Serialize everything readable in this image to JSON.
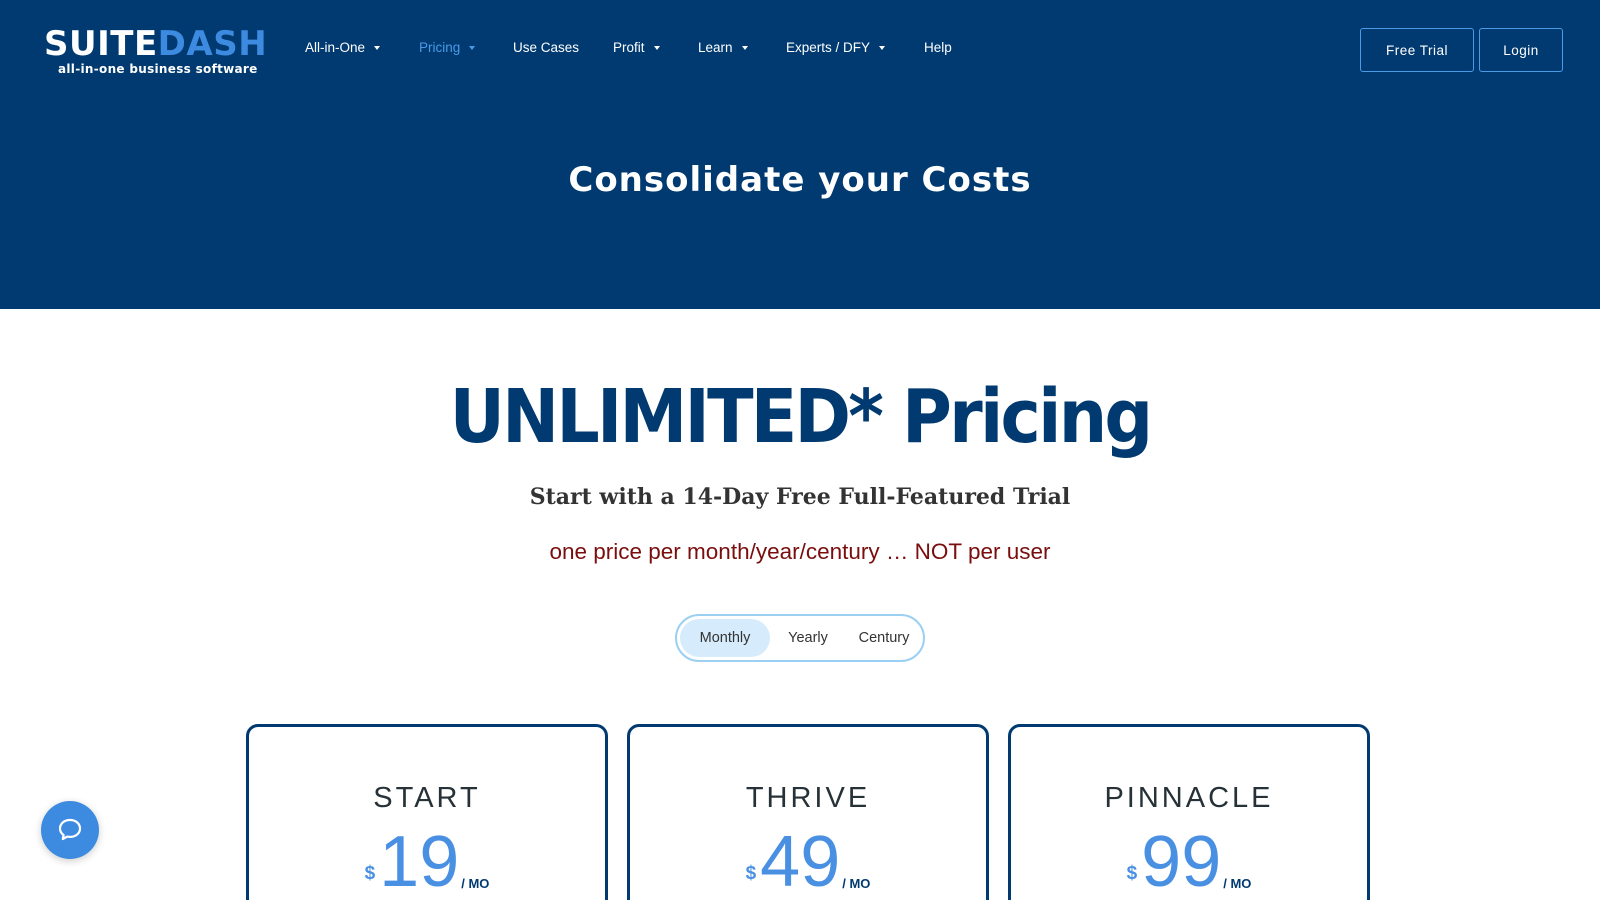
{
  "brand": {
    "name_part1": "SUITE",
    "name_part2": "DASH",
    "tagline": "all-in-one business software"
  },
  "nav": {
    "items": [
      {
        "label": "All-in-One",
        "has_dropdown": true,
        "active": false
      },
      {
        "label": "Pricing",
        "has_dropdown": true,
        "active": true
      },
      {
        "label": "Use Cases",
        "has_dropdown": false,
        "active": false
      },
      {
        "label": "Profit",
        "has_dropdown": true,
        "active": false
      },
      {
        "label": "Learn",
        "has_dropdown": true,
        "active": false
      },
      {
        "label": "Experts / DFY",
        "has_dropdown": true,
        "active": false
      },
      {
        "label": "Help",
        "has_dropdown": false,
        "active": false
      }
    ],
    "free_trial_label": "Free Trial",
    "login_label": "Login"
  },
  "hero": {
    "title": "Consolidate your Costs"
  },
  "pricing": {
    "title": "UNLIMITED* Pricing",
    "subtitle": "Start with a 14-Day Free Full-Featured Trial",
    "tagline": "one price per month/year/century … NOT per user",
    "billing_options": [
      "Monthly",
      "Yearly",
      "Century"
    ],
    "selected_billing": "Monthly",
    "plans": [
      {
        "name": "START",
        "currency": "$",
        "price": "19",
        "period": "/ MO"
      },
      {
        "name": "THRIVE",
        "currency": "$",
        "price": "49",
        "period": "/ MO"
      },
      {
        "name": "PINNACLE",
        "currency": "$",
        "price": "99",
        "period": "/ MO"
      }
    ]
  },
  "colors": {
    "header_bg": "#003a70",
    "accent": "#4a90e2",
    "tagline_red": "#7a0d0d",
    "toggle_selected": "#d6ebfb"
  },
  "icons": {
    "chat": "chat-bubble-icon",
    "dropdown": "caret-down-icon"
  }
}
